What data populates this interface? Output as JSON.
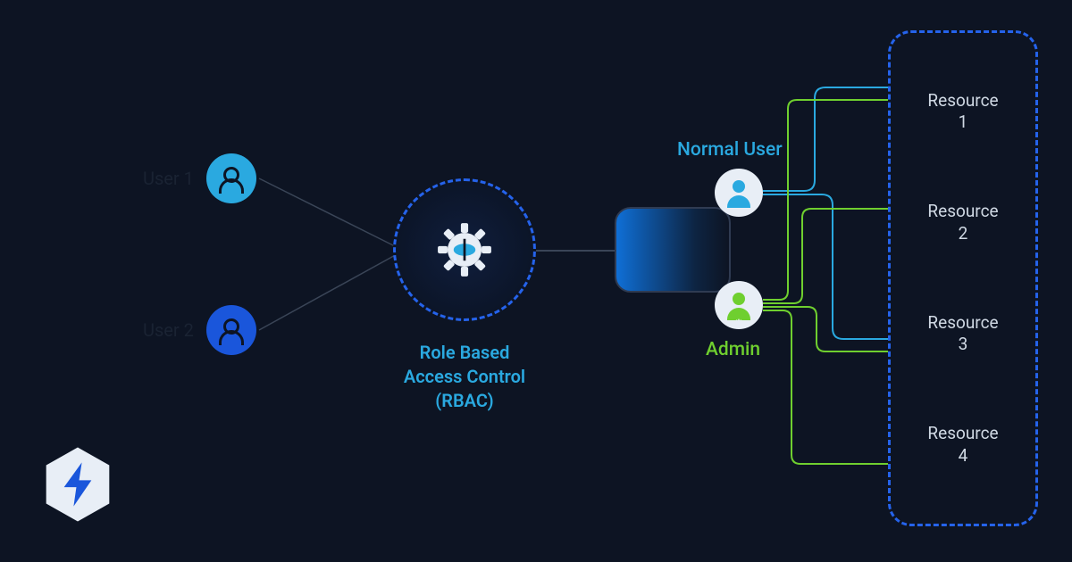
{
  "users": [
    {
      "label": "User 1"
    },
    {
      "label": "User 2"
    }
  ],
  "rbac": {
    "title_line1": "Role Based",
    "title_line2": "Access Control",
    "title_line3": "(RBAC)"
  },
  "roles": {
    "normal": {
      "label": "Normal User",
      "color": "#2aa9e0"
    },
    "admin": {
      "label": "Admin",
      "color": "#6fcf2f"
    }
  },
  "resources": [
    {
      "label_l1": "Resource",
      "label_l2": "1"
    },
    {
      "label_l1": "Resource",
      "label_l2": "2"
    },
    {
      "label_l1": "Resource",
      "label_l2": "3"
    },
    {
      "label_l1": "Resource",
      "label_l2": "4"
    }
  ],
  "connections": {
    "normal_user_resources": [
      1,
      3
    ],
    "admin_resources": [
      1,
      2,
      3,
      4
    ]
  },
  "colors": {
    "bg": "#0d1423",
    "blue_accent": "#2563eb",
    "light_blue": "#2aa9e0",
    "green": "#6fcf2f",
    "grey_line": "#3a4557"
  }
}
